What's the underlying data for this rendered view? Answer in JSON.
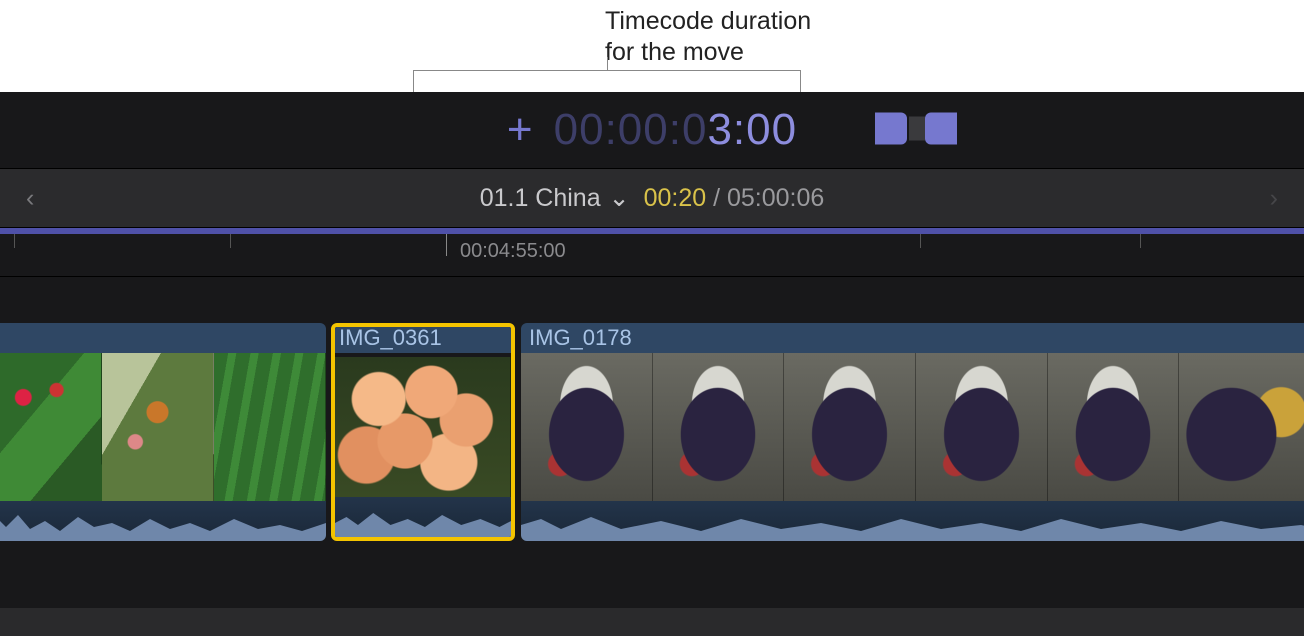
{
  "annotation": {
    "line1": "Timecode duration",
    "line2": "for the move"
  },
  "timecode": {
    "plus": "+",
    "dim_prefix": "00:00:0",
    "bright": "3:00"
  },
  "project": {
    "prev_glyph": "‹",
    "next_glyph": "›",
    "name": "01.1 China",
    "chevron_glyph": "⌄",
    "current_time": "00:20",
    "separator": " / ",
    "total_time": "05:00:06"
  },
  "ruler": {
    "label": "00:04:55:00"
  },
  "clips": [
    {
      "name": "",
      "selected": false
    },
    {
      "name": "IMG_0361",
      "selected": true
    },
    {
      "name": "IMG_0178",
      "selected": false
    }
  ],
  "colors": {
    "accent_purple": "#8d8dde",
    "accent_purple_dim": "#3d3e68",
    "selection_yellow": "#f4c400",
    "timecode_yellow": "#d9c24a"
  }
}
